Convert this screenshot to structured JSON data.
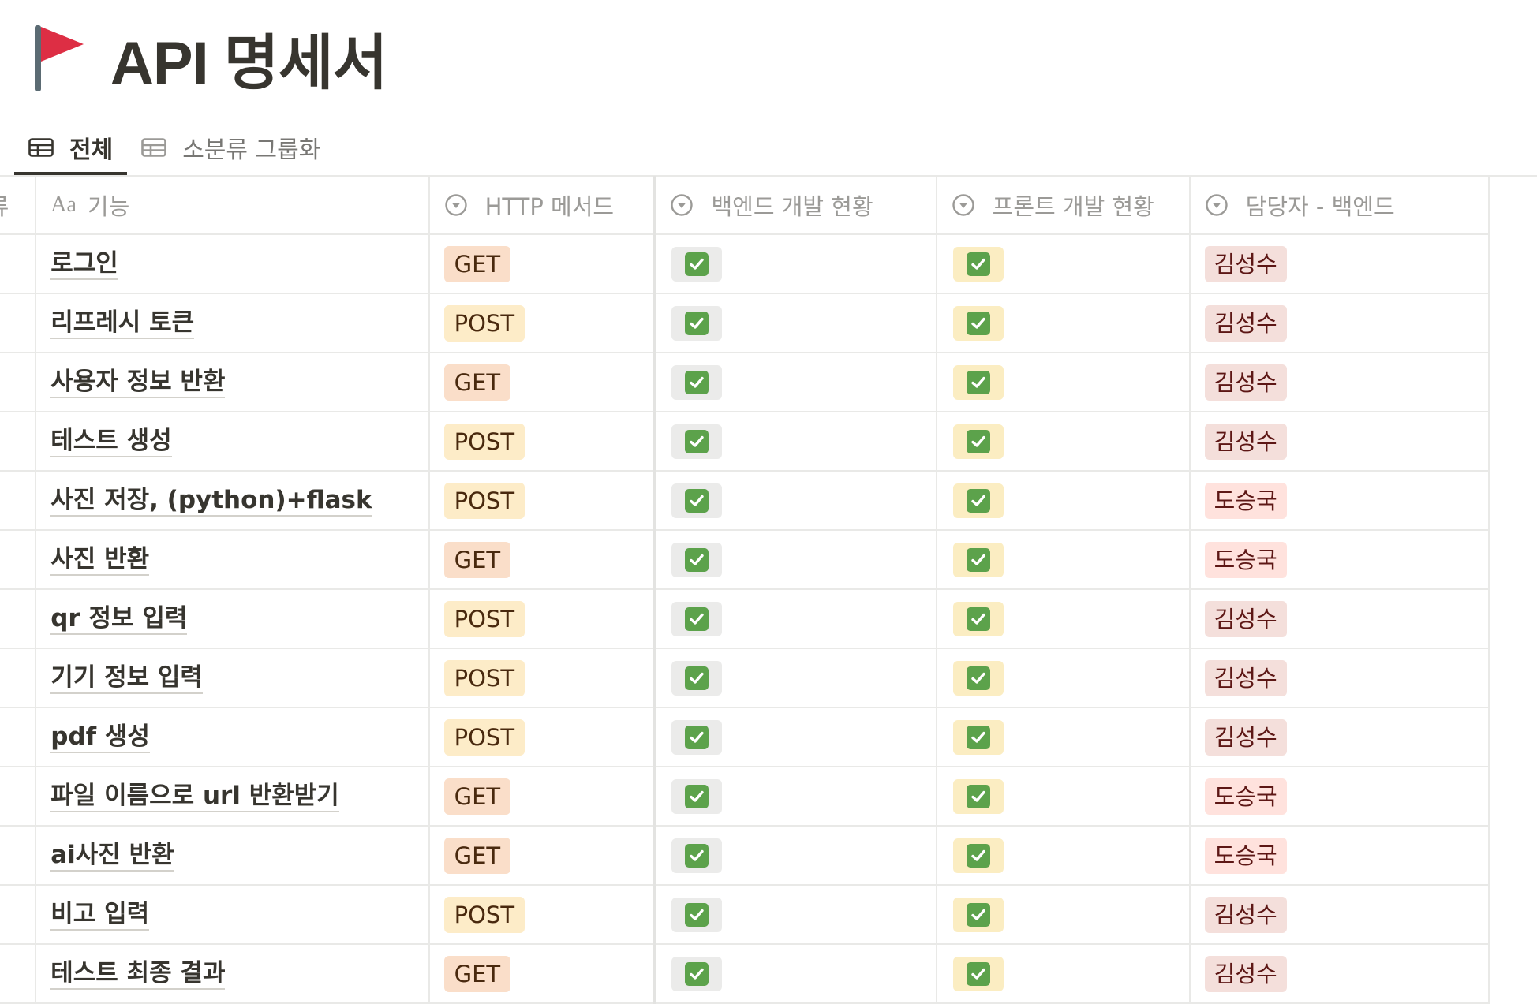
{
  "page": {
    "title": "API 명세서",
    "icon": "red-flag-icon"
  },
  "tabs": [
    {
      "label": "전체",
      "icon": "table-icon",
      "active": true
    },
    {
      "label": "소분류 그룹화",
      "icon": "table-icon",
      "active": false
    }
  ],
  "columns": {
    "category": "분류",
    "name_prefix": "Aa",
    "name": "기능",
    "method": "HTTP 메서드",
    "backend": "백엔드 개발 현황",
    "frontend": "프론트 개발 현황",
    "owner": "담당자 - 백엔드"
  },
  "colors": {
    "get_tag": "#fadec9",
    "post_tag": "#fdecc8",
    "check_green": "#5ca24b"
  },
  "rows": [
    {
      "name": "로그인",
      "method": "GET",
      "backend_done": true,
      "frontend_done": true,
      "owner": "김성수"
    },
    {
      "name": "리프레시 토큰",
      "method": "POST",
      "backend_done": true,
      "frontend_done": true,
      "owner": "김성수"
    },
    {
      "name": "사용자 정보 반환",
      "method": "GET",
      "backend_done": true,
      "frontend_done": true,
      "owner": "김성수"
    },
    {
      "name": "테스트 생성",
      "method": "POST",
      "backend_done": true,
      "frontend_done": true,
      "owner": "김성수"
    },
    {
      "name": "사진 저장, (python)+flask",
      "method": "POST",
      "backend_done": true,
      "frontend_done": true,
      "owner": "도승국"
    },
    {
      "name": "사진 반환",
      "method": "GET",
      "backend_done": true,
      "frontend_done": true,
      "owner": "도승국"
    },
    {
      "name": "qr 정보 입력",
      "method": "POST",
      "backend_done": true,
      "frontend_done": true,
      "owner": "김성수"
    },
    {
      "name": "기기 정보 입력",
      "method": "POST",
      "backend_done": true,
      "frontend_done": true,
      "owner": "김성수"
    },
    {
      "name": "pdf 생성",
      "method": "POST",
      "backend_done": true,
      "frontend_done": true,
      "owner": "김성수"
    },
    {
      "name": "파일 이름으로 url 반환받기",
      "method": "GET",
      "backend_done": true,
      "frontend_done": true,
      "owner": "도승국"
    },
    {
      "name": "ai사진 반환",
      "method": "GET",
      "backend_done": true,
      "frontend_done": true,
      "owner": "도승국"
    },
    {
      "name": "비고 입력",
      "method": "POST",
      "backend_done": true,
      "frontend_done": true,
      "owner": "김성수"
    },
    {
      "name": "테스트 최종 결과",
      "method": "GET",
      "backend_done": true,
      "frontend_done": true,
      "owner": "김성수"
    }
  ]
}
